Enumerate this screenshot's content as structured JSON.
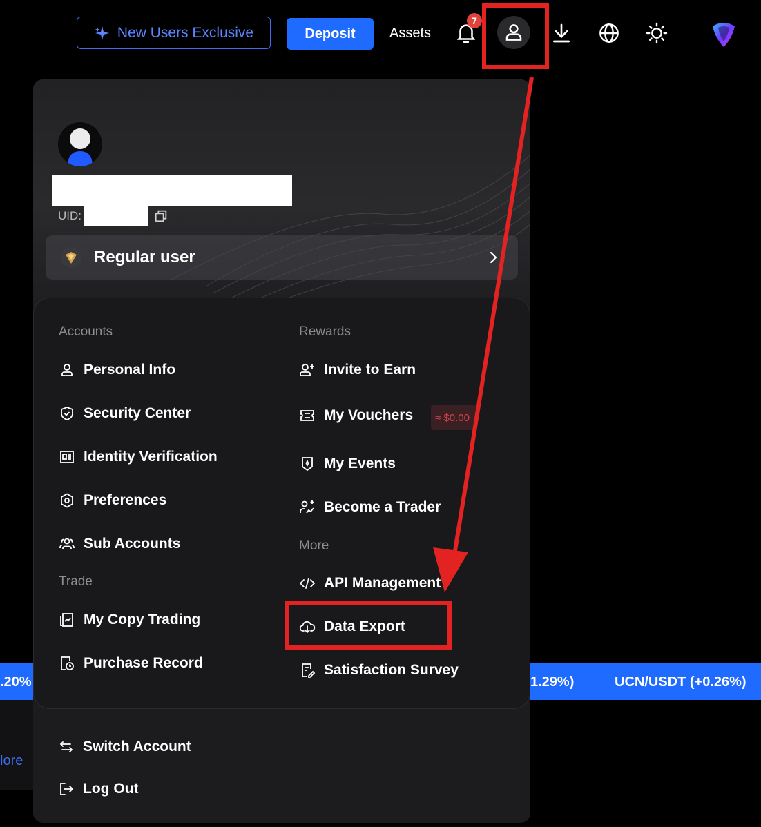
{
  "topbar": {
    "new_users_label": "New Users Exclusive",
    "deposit_label": "Deposit",
    "assets_label": "Assets",
    "notification_count": "7"
  },
  "profile": {
    "uid_label": "UID:",
    "level_label": "Regular user"
  },
  "menu": {
    "accounts_title": "Accounts",
    "accounts": [
      "Personal Info",
      "Security Center",
      "Identity Verification",
      "Preferences",
      "Sub Accounts"
    ],
    "trade_title": "Trade",
    "trade": [
      "My Copy Trading",
      "Purchase Record"
    ],
    "rewards_title": "Rewards",
    "rewards": [
      "Invite to Earn",
      "My Vouchers",
      "My Events",
      "Become a Trader"
    ],
    "voucher_badge": "≈ $0.00",
    "more_title": "More",
    "more": [
      "API Management",
      "Data Export",
      "Satisfaction Survey"
    ]
  },
  "footer": {
    "switch_account": "Switch Account",
    "log_out": "Log Out"
  },
  "background": {
    "ticker_left": ".20%",
    "ticker_mid": "1.29%)",
    "ticker_right": "UCN/USDT (+0.26%)",
    "more_link": "lore"
  },
  "colors": {
    "accent": "#1f6bff",
    "annotation": "#e32222",
    "badge": "#e0433a"
  }
}
